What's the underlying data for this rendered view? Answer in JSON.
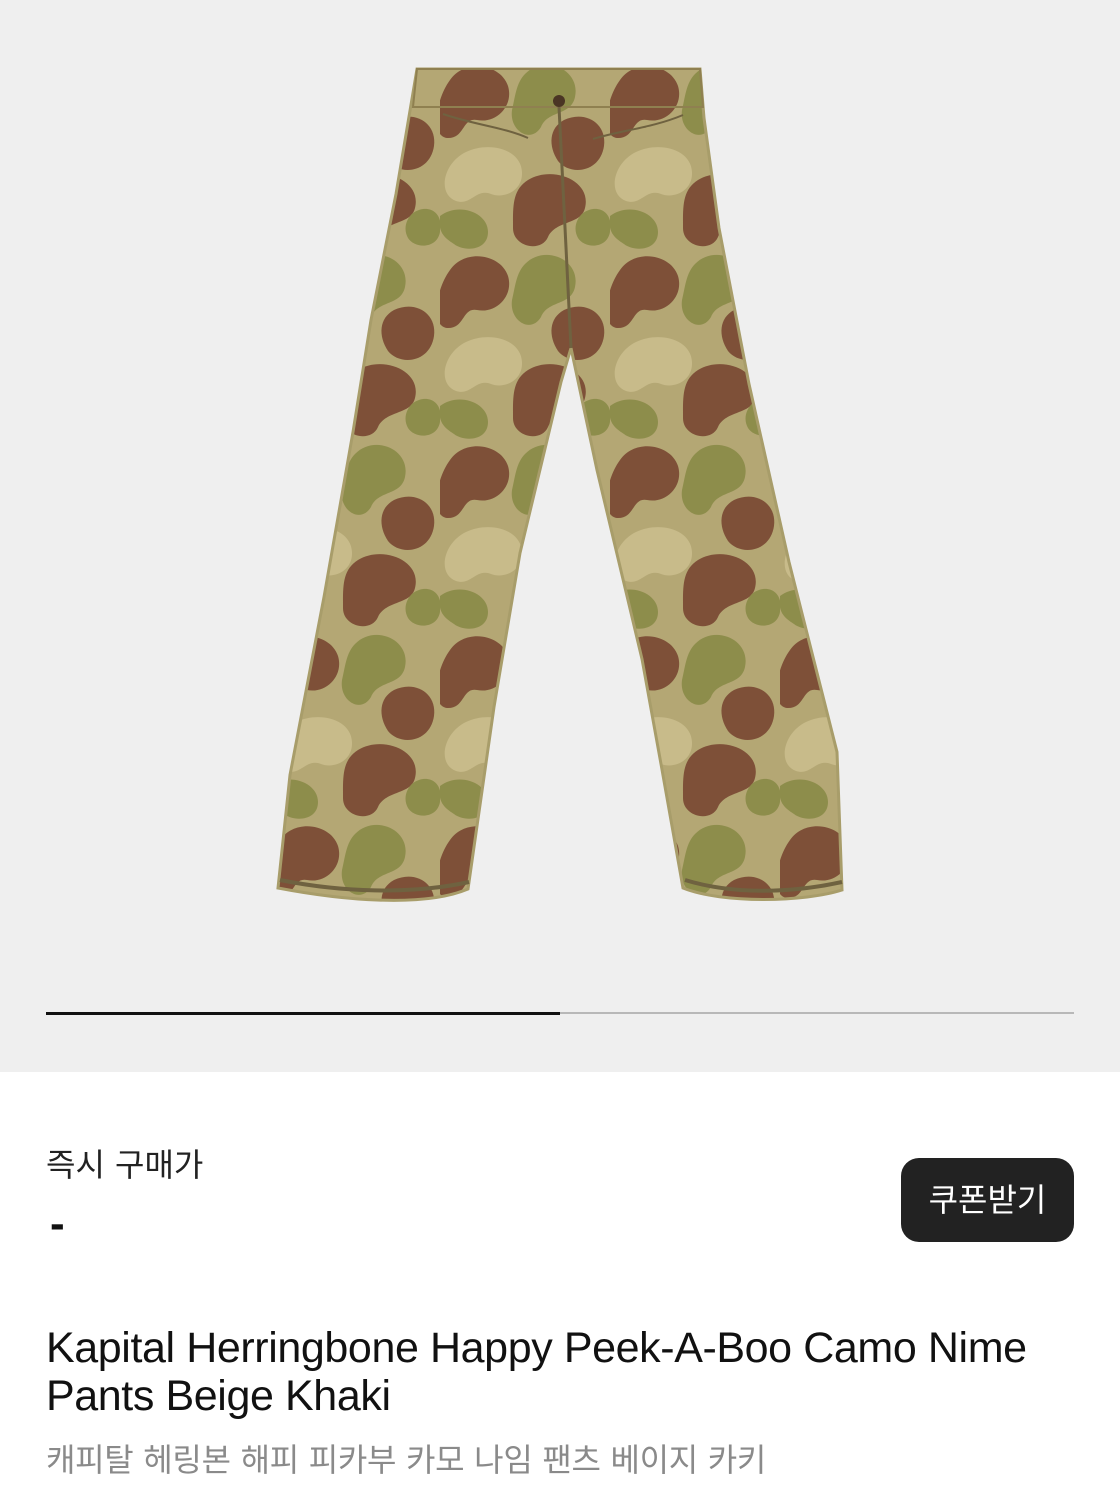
{
  "gallery": {
    "background": "#efefef",
    "image_alt": "Kapital Herringbone Happy Peek-A-Boo Camo Nime Pants Beige Khaki",
    "progress": 0.5,
    "progress_track_color": "#b8b8b8",
    "progress_fill_color": "#111111"
  },
  "price": {
    "label": "즉시 구매가",
    "value": "-"
  },
  "coupon": {
    "label": "쿠폰받기",
    "background": "#222222"
  },
  "product": {
    "title": "Kapital Herringbone Happy Peek-A-Boo Camo Nime Pants Beige Khaki",
    "subtitle": "캐피탈 헤링본 해피 피카부 카모 나임 팬츠 베이지 카키"
  },
  "colors": {
    "camo_base": "#b4a774",
    "camo_brown": "#7e5038",
    "camo_green": "#8d8d4b",
    "camo_light": "#c8bb8a"
  }
}
